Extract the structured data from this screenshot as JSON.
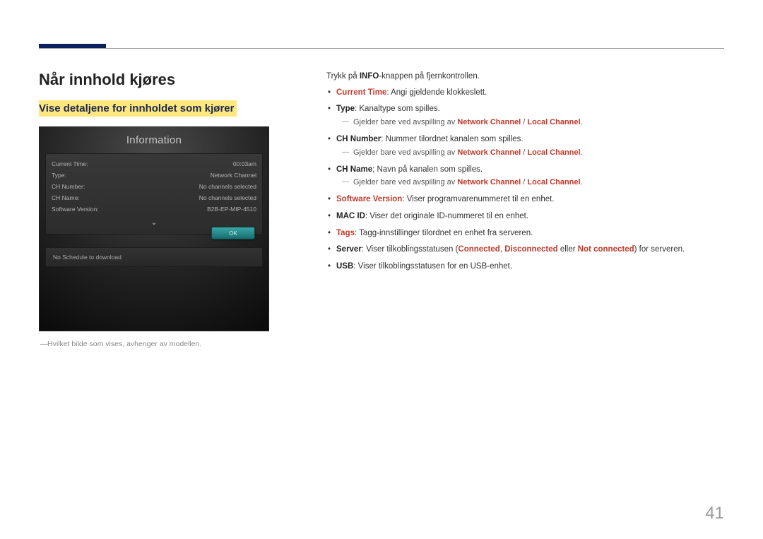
{
  "page_number": "41",
  "heading": "Når innhold kjøres",
  "subheading": "Vise detaljene for innholdet som kjører",
  "screenshot": {
    "title": "Information",
    "rows": [
      {
        "label": "Current Time:",
        "value": "00:03am"
      },
      {
        "label": "Type:",
        "value": "Network Channel"
      },
      {
        "label": "CH Number:",
        "value": "No channels selected"
      },
      {
        "label": "CH Name:",
        "value": "No channels selected"
      },
      {
        "label": "Software Version:",
        "value": "B2B-EP-MIP-4510"
      }
    ],
    "ok_label": "OK",
    "schedule_text": "No Schedule to download"
  },
  "footnote": "Hvilket bilde som vises, avhenger av modellen.",
  "intro_pre": "Trykk på ",
  "intro_bold": "INFO",
  "intro_post": "-knappen på fjernkontrollen.",
  "items": {
    "current_time": {
      "term": "Current Time",
      "desc": ": Angi gjeldende klokkeslett."
    },
    "type": {
      "term": "Type",
      "desc": ": Kanaltype som spilles."
    },
    "applies": {
      "pre": "Gjelder bare ved avspilling av ",
      "nc": "Network Channel",
      "sep": " / ",
      "lc": "Local Channel",
      "post": "."
    },
    "ch_number": {
      "term": "CH Number",
      "desc": ": Nummer tilordnet kanalen som spilles."
    },
    "ch_name": {
      "term": "CH Name",
      "desc": "; Navn på kanalen som spilles."
    },
    "software_version": {
      "term": "Software Version",
      "desc": ": Viser programvarenummeret til en enhet."
    },
    "mac_id": {
      "term": "MAC ID",
      "desc": ": Viser det originale ID-nummeret til en enhet."
    },
    "tags": {
      "term": "Tags",
      "desc": ": Tagg-innstillinger tilordnet en enhet fra serveren."
    },
    "server": {
      "term": "Server",
      "pre": ": Viser tilkoblingsstatusen (",
      "s1": "Connected",
      "c1": ", ",
      "s2": "Disconnected",
      "c2": " eller ",
      "s3": "Not connected",
      "post": ") for serveren."
    },
    "usb": {
      "term": "USB",
      "desc": ": Viser tilkoblingsstatusen for en USB-enhet."
    }
  }
}
